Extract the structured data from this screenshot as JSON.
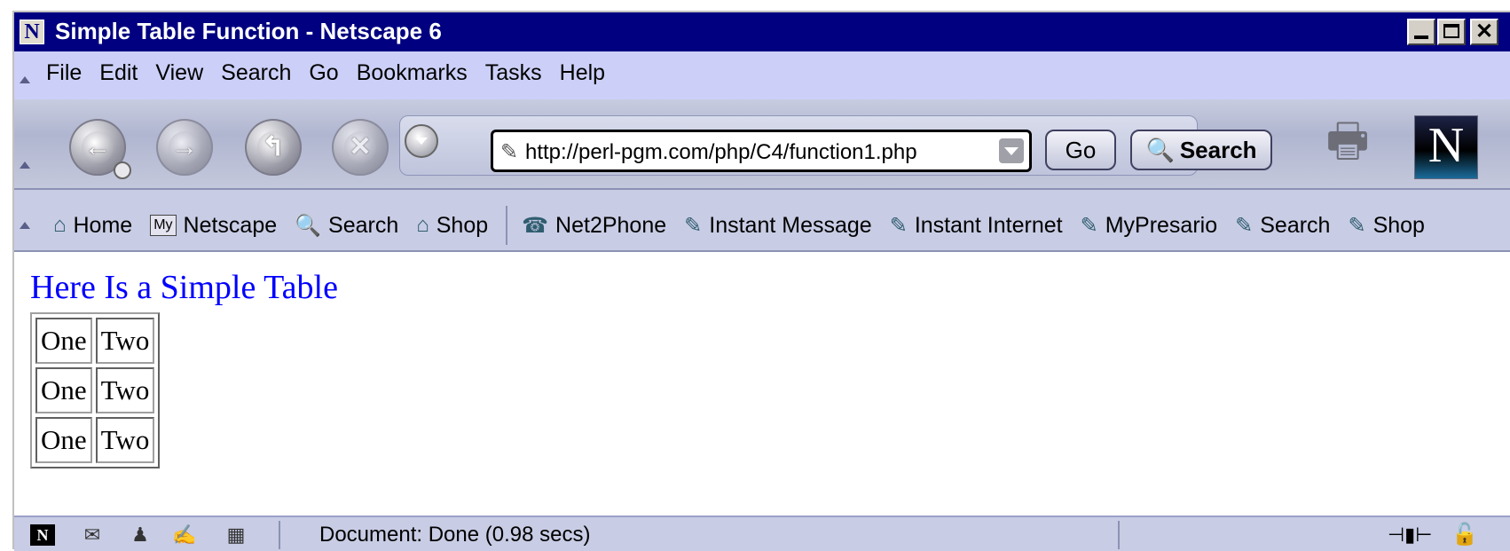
{
  "window": {
    "title": "Simple Table Function - Netscape 6"
  },
  "menu": [
    "File",
    "Edit",
    "View",
    "Search",
    "Go",
    "Bookmarks",
    "Tasks",
    "Help"
  ],
  "navigation": {
    "url": "http://perl-pgm.com/php/C4/function1.php",
    "go_label": "Go",
    "search_label": "Search",
    "logo_letter": "N"
  },
  "personal_toolbar": {
    "items": [
      "Home",
      "Netscape",
      "Search",
      "Shop",
      "Net2Phone",
      "Instant Message",
      "Instant Internet",
      "MyPresario",
      "Search",
      "Shop"
    ],
    "my_badge": "My"
  },
  "page": {
    "heading": "Here Is a Simple Table",
    "table": [
      [
        "One",
        "Two"
      ],
      [
        "One",
        "Two"
      ],
      [
        "One",
        "Two"
      ]
    ]
  },
  "status": {
    "text": "Document: Done (0.98 secs)",
    "n_badge": "N"
  },
  "colors": {
    "titlebar": "#000080",
    "heading": "#0000ff",
    "menubar": "#ccd0f8"
  }
}
